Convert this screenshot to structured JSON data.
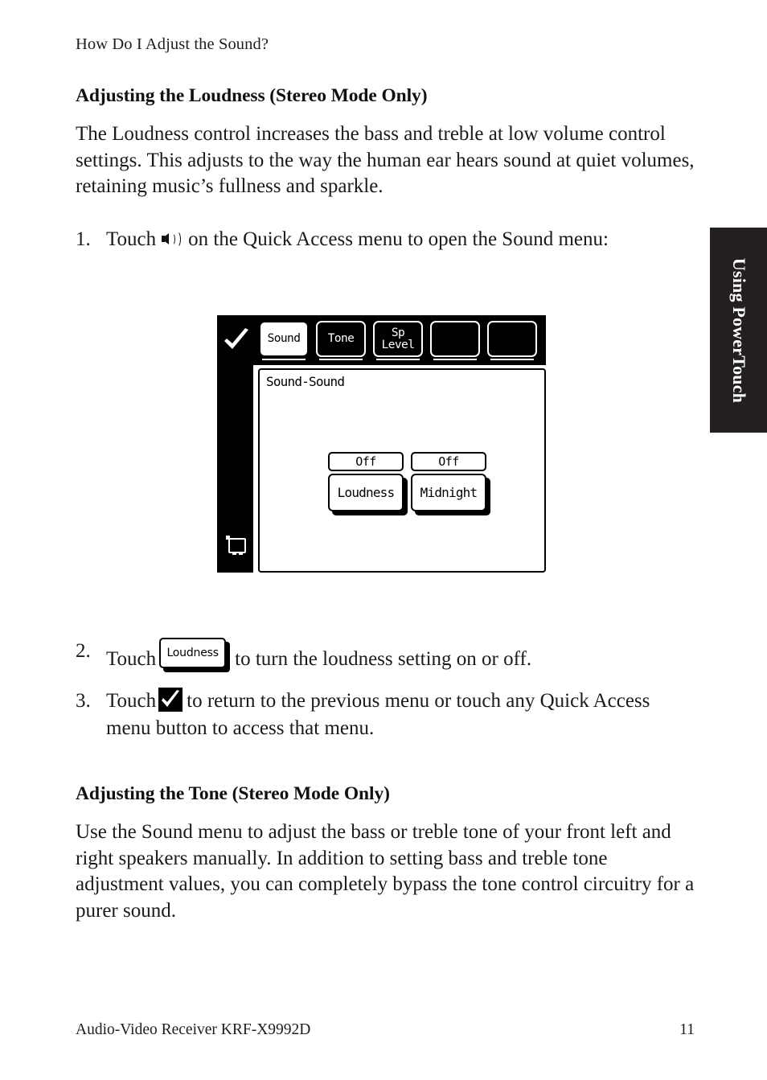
{
  "page": {
    "running_head": "How Do I Adjust the Sound?",
    "footer_left": "Audio-Video Receiver KRF-X9992D",
    "footer_page_number": "11",
    "side_tab_label": "Using PowerTouch"
  },
  "sections": [
    {
      "heading": "Adjusting the Loudness (Stereo Mode Only)",
      "paragraph": "The Loudness control increases the bass and treble at low volume control settings. This adjusts to the way the human ear hears sound at quiet volumes, retaining music’s fullness and sparkle."
    },
    {
      "heading": "Adjusting the Tone (Stereo Mode Only)",
      "paragraph": "Use the Sound menu to adjust the bass or treble tone of your front left and right speakers manually. In addition to setting bass and treble tone adjustment values, you can completely bypass the tone control circuitry for a purer sound."
    }
  ],
  "steps": [
    {
      "number": "1.",
      "text_before": "Touch",
      "icon": "speaker-icon",
      "text_after": "on the Quick Access menu to open the Sound menu:"
    },
    {
      "number": "2.",
      "text_before": "Touch",
      "inline_button_label": "Loudness",
      "text_after": "to turn the loudness setting on or off."
    },
    {
      "number": "3.",
      "text_before": "Touch",
      "icon": "check-tile-icon",
      "text_after": "to return to the previous menu or touch any Quick Access menu button to access that menu."
    }
  ],
  "device_screen": {
    "check_icon": "check-icon",
    "screen_icon": "monitor-icon",
    "quick_access_buttons": [
      {
        "label": "Sound",
        "selected": true
      },
      {
        "label": "Tone",
        "selected": false
      },
      {
        "label": "Sp\nLevel",
        "selected": false
      },
      {
        "label": "",
        "selected": false
      },
      {
        "label": "",
        "selected": false
      }
    ],
    "panel_title": "Sound-Sound",
    "toggles": [
      {
        "value": "Off",
        "label": "Loudness"
      },
      {
        "value": "Off",
        "label": "Midnight"
      }
    ]
  },
  "colors": {
    "ink": "#1a1a1a",
    "tab_background": "#231f20",
    "lcd_black": "#000000",
    "lcd_white": "#ffffff"
  }
}
